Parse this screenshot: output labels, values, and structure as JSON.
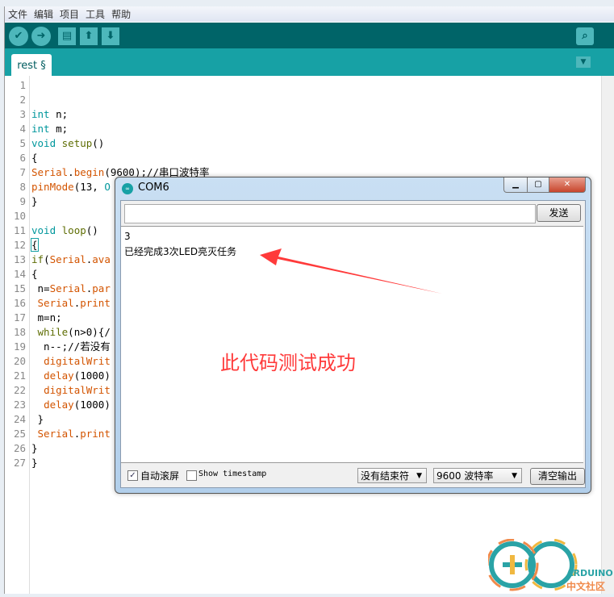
{
  "menu": [
    "文件",
    "编辑",
    "项目",
    "工具",
    "帮助"
  ],
  "toolbar": {
    "icons": [
      "verify-icon",
      "upload-icon",
      "new-icon",
      "open-icon",
      "save-icon",
      "serial-monitor-icon"
    ]
  },
  "tab": {
    "label": "rest §"
  },
  "code": {
    "line_numbers": [
      "1",
      "2",
      "3",
      "4",
      "5",
      "6",
      "7",
      "8",
      "9",
      "10",
      "11",
      "12",
      "13",
      "14",
      "15",
      "16",
      "17",
      "18",
      "19",
      "20",
      "21",
      "22",
      "23",
      "24",
      "25",
      "26",
      "27"
    ]
  },
  "serial": {
    "title": "COM6",
    "send_value": "",
    "send_label": "发送",
    "output": [
      "3",
      "已经完成3次LED亮灭任务"
    ],
    "autoscroll_label": "自动滚屏",
    "autoscroll_checked": true,
    "timestamp_label": "Show timestamp",
    "timestamp_checked": false,
    "line_ending": "没有结束符",
    "baud": "9600 波特率",
    "clear_label": "清空输出"
  },
  "annotation": "此代码测试成功",
  "logo": {
    "text1": "ARDUINO",
    "text2": "中文社区"
  },
  "colors": {
    "toolbar": "#006468",
    "tabbar": "#17a1a5",
    "annotation": "#ff3a3a",
    "keyword": "#00979c",
    "function": "#d35400"
  }
}
